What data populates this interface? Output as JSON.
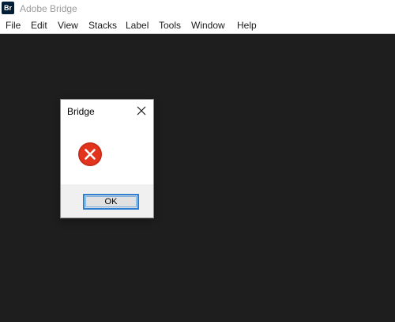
{
  "app": {
    "icon_text": "Br",
    "title": "Adobe Bridge",
    "icon_color": "#001e36"
  },
  "menu": {
    "items": [
      "File",
      "Edit",
      "View",
      "Stacks",
      "Label",
      "Tools",
      "Window",
      "Help"
    ]
  },
  "dialog": {
    "title": "Bridge",
    "close_icon": "close-icon",
    "status_icon": "error-icon",
    "error_color": "#e2331c",
    "ok_label": "OK",
    "ok_focus_color": "#2f7fd0"
  },
  "colors": {
    "workspace_background": "#1e1e1e",
    "chrome_background": "#ffffff",
    "dialog_footer": "#f0f0f0"
  }
}
